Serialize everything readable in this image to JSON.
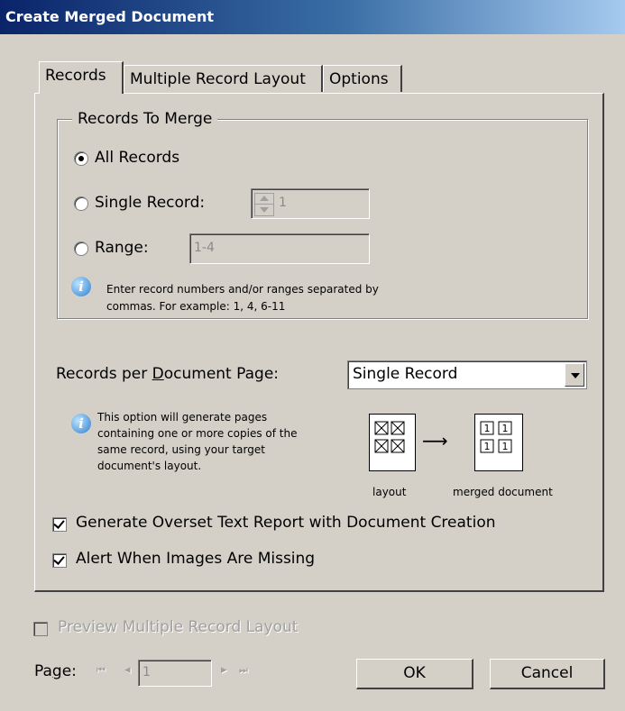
{
  "window": {
    "title": "Create Merged Document"
  },
  "tabs": [
    {
      "label": "Records"
    },
    {
      "label": "Multiple Record Layout"
    },
    {
      "label": "Options"
    }
  ],
  "records_to_merge": {
    "legend": "Records To Merge",
    "all_records": {
      "label": "All Records",
      "selected": true
    },
    "single_record": {
      "label": "Single Record:",
      "value": "1"
    },
    "range": {
      "label": "Range:",
      "value": "1-4"
    },
    "hint_line1": "Enter record numbers and/or ranges separated by",
    "hint_line2": "commas. For example: 1, 4, 6-11"
  },
  "records_per_page": {
    "label_pre": "Records per ",
    "label_u": "D",
    "label_post": "ocument Page:",
    "value": "Single Record",
    "info_lines": [
      "This option will generate pages",
      "containing one or more copies of the",
      "same record, using your target",
      "document's layout."
    ],
    "layout_caption": "layout",
    "merged_caption": "merged document",
    "arrow": "⟶"
  },
  "options": {
    "overset": {
      "label": "Generate Overset Text Report with Document Creation",
      "checked": true
    },
    "missing_images": {
      "label": "Alert When Images Are Missing",
      "checked": true
    }
  },
  "preview": {
    "label": "Preview Multiple Record Layout",
    "checked": false
  },
  "pager": {
    "label_pre": "Pa",
    "label_u": "g",
    "label_post": "e:",
    "value": "1",
    "first": "⏮",
    "prev": "◂",
    "next": "▸",
    "last": "⏭"
  },
  "buttons": {
    "ok": "OK",
    "cancel": "Cancel"
  }
}
